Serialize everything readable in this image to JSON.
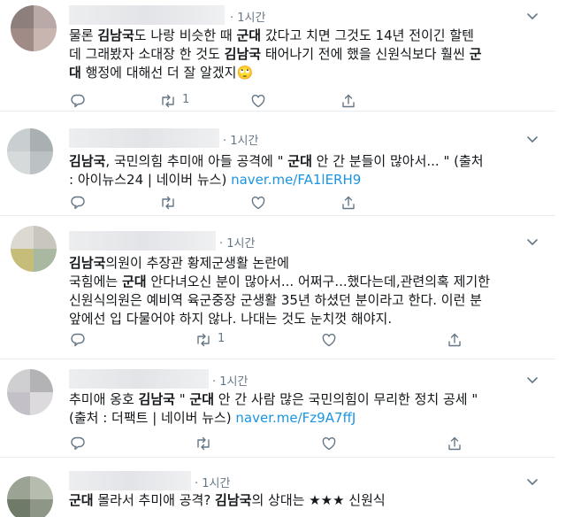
{
  "tweets": [
    {
      "time": "· 1시간",
      "lines": [
        [
          {
            "t": "물론 "
          },
          {
            "t": "김남국",
            "b": true
          },
          {
            "t": "도 나랑 비슷한 때 "
          },
          {
            "t": "군대",
            "b": true
          },
          {
            "t": " 갔다고 치면 그것도 14년 전이긴 할텐"
          }
        ],
        [
          {
            "t": "데 그래봤자 소대장 한 것도 "
          },
          {
            "t": "김남국",
            "b": true
          },
          {
            "t": " 태어나기 전에 했을 신원식보다 훨씬 "
          },
          {
            "t": "군",
            "b": true
          }
        ],
        [
          {
            "t": "대",
            "b": true
          },
          {
            "t": " 행정에 대해선 더 잘 알겠지🙄"
          }
        ]
      ],
      "retweet_count": "1"
    },
    {
      "time": "· 1시간",
      "lines": [
        [
          {
            "t": "김남국",
            "b": true
          },
          {
            "t": ", 국민의힘 추미애 아들 공격에 \" "
          },
          {
            "t": "군대",
            "b": true
          },
          {
            "t": " 안 간 분들이 많아서... \" (출처"
          }
        ],
        [
          {
            "t": ": 아이뉴스24 | 네이버 뉴스) "
          },
          {
            "t": "naver.me/FA1lERH9",
            "link": true
          }
        ]
      ],
      "retweet_count": ""
    },
    {
      "time": "· 1시간",
      "lines": [
        [
          {
            "t": "김남국",
            "b": true
          },
          {
            "t": "의원이 추장관 황제군생활 논란에"
          }
        ],
        [
          {
            "t": "국힘에는 "
          },
          {
            "t": "군대",
            "b": true
          },
          {
            "t": " 안다녀오신 분이 많아서... 어쩌구...했다는데,관련의혹 제기한"
          }
        ],
        [
          {
            "t": "신원식의원은 예비역 육군중장 군생활 35년 하셨던 분이라고 한다. 이런 분"
          }
        ],
        [
          {
            "t": "앞에선 입 다물어야 하지 않나. 나대는 것도 눈치껏 해야지."
          }
        ]
      ],
      "retweet_count": "1"
    },
    {
      "time": "· 1시간",
      "lines": [
        [
          {
            "t": "추미애 옹호 "
          },
          {
            "t": "김남국",
            "b": true
          },
          {
            "t": " \" "
          },
          {
            "t": "군대",
            "b": true
          },
          {
            "t": " 안 간 사람 많은 국민의힘이 무리한 정치 공세 \""
          }
        ],
        [
          {
            "t": "(출처 : 더팩트 | 네이버 뉴스) "
          },
          {
            "t": "naver.me/Fz9A7ffJ",
            "link": true
          }
        ]
      ],
      "retweet_count": ""
    },
    {
      "time": "· 1시간",
      "lines": [
        [
          {
            "t": "군대",
            "b": true
          },
          {
            "t": " 몰라서 추미애 공격? "
          },
          {
            "t": "김남국",
            "b": true
          },
          {
            "t": "의 상대는 ★★★ 신원식"
          }
        ]
      ],
      "retweet_count": ""
    }
  ],
  "icons": {
    "reply": "reply-icon",
    "retweet": "retweet-icon",
    "like": "like-icon",
    "share": "share-icon",
    "caret": "chevron-down-icon"
  },
  "colors": {
    "text": "#14171a",
    "muted": "#657786",
    "link": "#1b95e0",
    "border": "#e6ecf0"
  }
}
